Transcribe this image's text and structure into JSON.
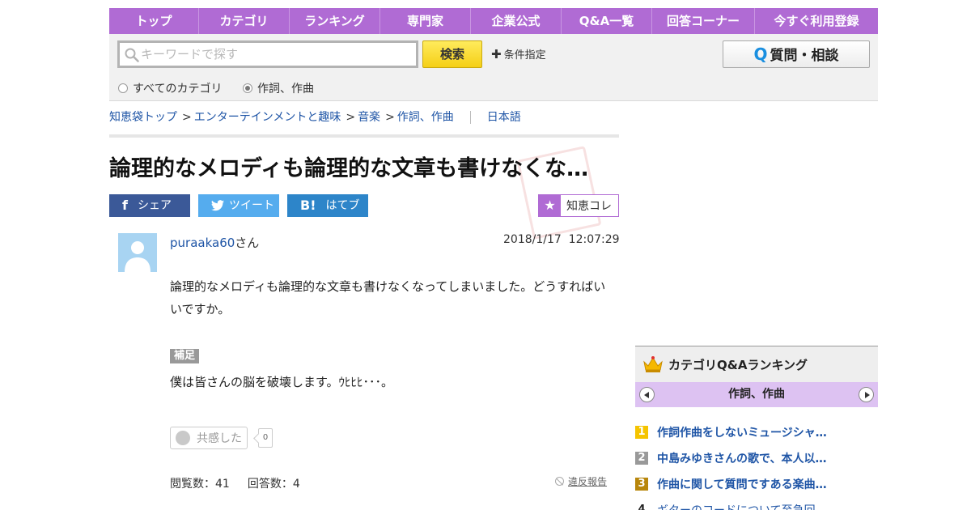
{
  "nav": {
    "items": [
      {
        "label": "トップ",
        "width": 111
      },
      {
        "label": "カテゴリ",
        "width": 112
      },
      {
        "label": "ランキング",
        "width": 112
      },
      {
        "label": "専門家",
        "width": 112
      },
      {
        "label": "企業公式",
        "width": 112
      },
      {
        "label": "Q&A一覧",
        "width": 112
      },
      {
        "label": "回答コーナー",
        "width": 127
      },
      {
        "label": "今すぐ利用登録",
        "width": 152
      }
    ]
  },
  "search": {
    "placeholder": "キーワードで探す",
    "button_label": "検索",
    "condition_label": "条件指定",
    "ask_label": "質問・相談",
    "radio_all": "すべてのカテゴリ",
    "radio_current": "作詞、作曲"
  },
  "breadcrumb": {
    "items": [
      "知恵袋トップ",
      "エンターテインメントと趣味",
      "音楽",
      "作詞、作曲"
    ],
    "language": "日本語"
  },
  "question": {
    "title": "論理的なメロディも論理的な文章も書けなくな…",
    "user": "puraaka60",
    "user_suffix": "さん",
    "datetime": "2018/1/17  12:07:29",
    "body": "論理的なメロディも論理的な文章も書けなくなってしまいました。どうすればいいですか。",
    "supplement_label": "補足",
    "supplement": "僕は皆さんの脳を破壊します。ｳﾋﾋﾋ･･･。",
    "empathy_label": "共感した",
    "empathy_count": "0",
    "views": "閲覧数：41",
    "answers": "回答数：4",
    "report": "違反報告"
  },
  "share": {
    "facebook": "シェア",
    "twitter": "ツイート",
    "hatena": "はてブ",
    "collection": "知恵コレ"
  },
  "ranking": {
    "title": "カテゴリQ&Aランキング",
    "category": "作詞、作曲",
    "items": [
      {
        "rank": "1",
        "text": "作詞作曲をしないミュージシャ…",
        "color": "#f5c400"
      },
      {
        "rank": "2",
        "text": "中島みゆきさんの歌で、本人以…",
        "color": "#999999"
      },
      {
        "rank": "3",
        "text": "作曲に関して質問ですある楽曲…",
        "color": "#b8860b"
      },
      {
        "rank": "4",
        "text": "ギターのコードについて至急回…",
        "color": ""
      }
    ]
  },
  "colors": {
    "accent": "#b06bd4",
    "link": "#1f55a6",
    "search_button": "#f5cf16"
  }
}
